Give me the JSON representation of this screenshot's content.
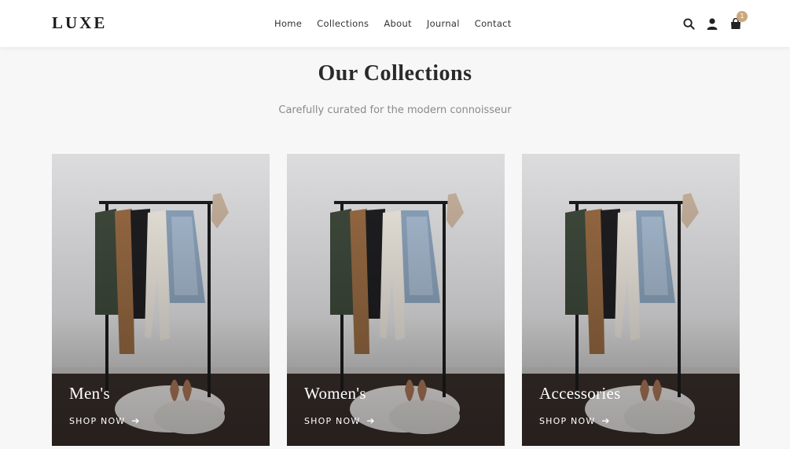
{
  "brand": {
    "logo": "LUXE"
  },
  "nav": {
    "items": [
      {
        "label": "Home"
      },
      {
        "label": "Collections"
      },
      {
        "label": "About"
      },
      {
        "label": "Journal"
      },
      {
        "label": "Contact"
      }
    ]
  },
  "header_icons": {
    "search": "search-icon",
    "account": "user-icon",
    "cart": "shopping-bag-icon",
    "cart_count": "1",
    "badge_color": "#c9a87c"
  },
  "section": {
    "title": "Our Collections",
    "subtitle": "Carefully curated for the modern connoisseur"
  },
  "collections": [
    {
      "name": "Men's",
      "cta": "SHOP NOW",
      "cta_icon": "arrow-right-icon"
    },
    {
      "name": "Women's",
      "cta": "SHOP NOW",
      "cta_icon": "arrow-right-icon"
    },
    {
      "name": "Accessories",
      "cta": "SHOP NOW",
      "cta_icon": "arrow-right-icon"
    }
  ]
}
